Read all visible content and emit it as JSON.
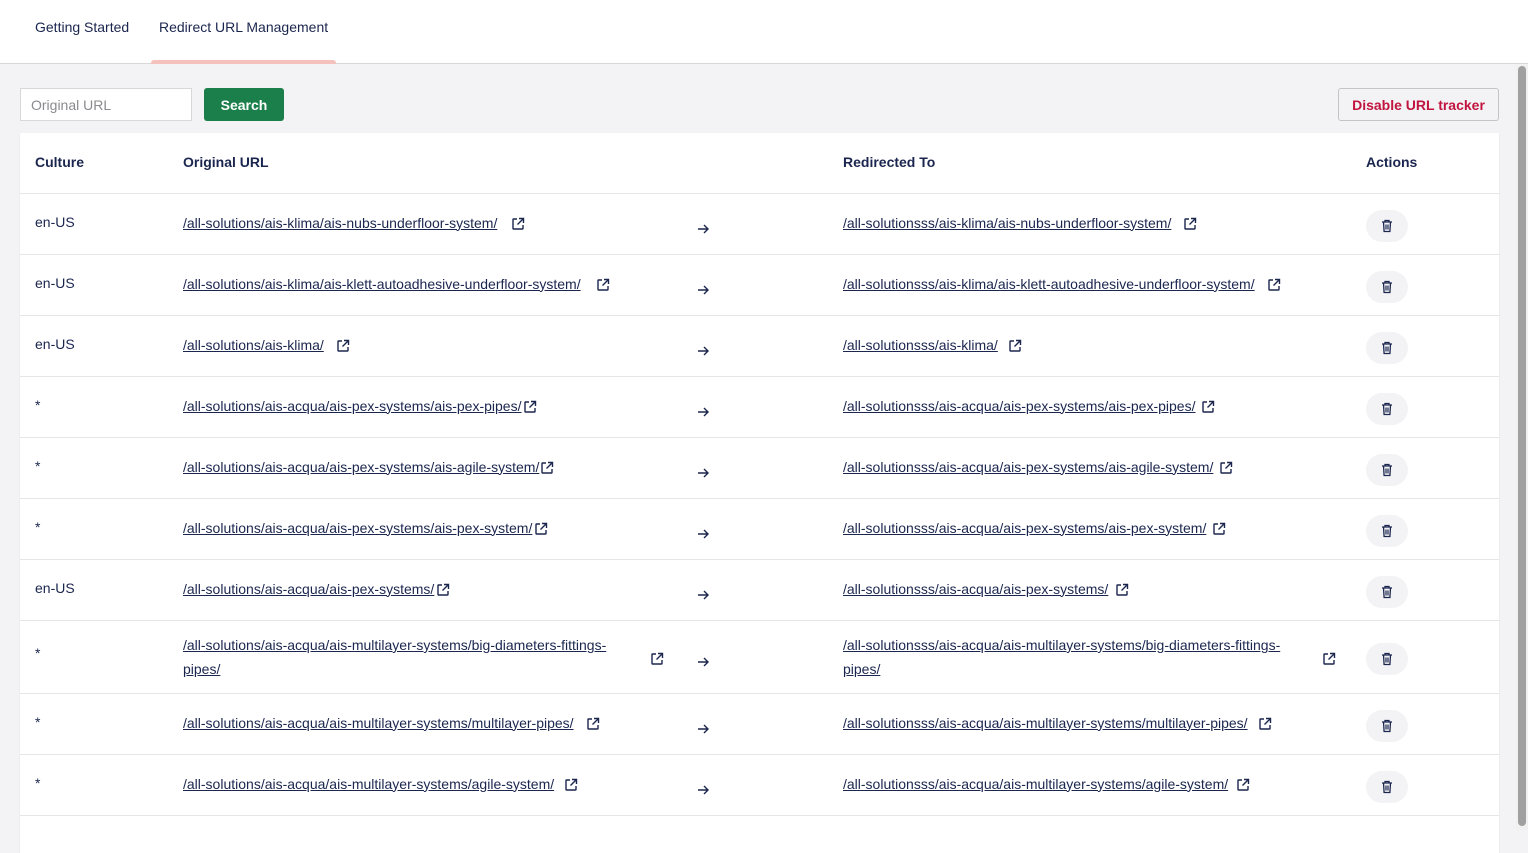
{
  "tabs": [
    {
      "label": "Getting Started"
    },
    {
      "label": "Redirect URL Management"
    }
  ],
  "search": {
    "placeholder": "Original URL",
    "button_label": "Search"
  },
  "disable_button": {
    "label": "Disable URL tracker"
  },
  "table": {
    "headers": {
      "culture": "Culture",
      "original": "Original URL",
      "redirected": "Redirected To",
      "actions": "Actions"
    },
    "rows": [
      {
        "culture": "en-US",
        "original": "/all-solutions/ais-klima/ais-nubs-underfloor-system/",
        "redirected": "/all-solutionsss/ais-klima/ais-nubs-underfloor-system/"
      },
      {
        "culture": "en-US",
        "original": "/all-solutions/ais-klima/ais-klett-autoadhesive-underfloor-system/",
        "redirected": "/all-solutionsss/ais-klima/ais-klett-autoadhesive-underfloor-system/"
      },
      {
        "culture": "en-US",
        "original": "/all-solutions/ais-klima/",
        "redirected": "/all-solutionsss/ais-klima/"
      },
      {
        "culture": "*",
        "original": "/all-solutions/ais-acqua/ais-pex-systems/ais-pex-pipes/",
        "redirected": "/all-solutionsss/ais-acqua/ais-pex-systems/ais-pex-pipes/"
      },
      {
        "culture": "*",
        "original": "/all-solutions/ais-acqua/ais-pex-systems/ais-agile-system/",
        "redirected": "/all-solutionsss/ais-acqua/ais-pex-systems/ais-agile-system/"
      },
      {
        "culture": "*",
        "original": "/all-solutions/ais-acqua/ais-pex-systems/ais-pex-system/",
        "redirected": "/all-solutionsss/ais-acqua/ais-pex-systems/ais-pex-system/"
      },
      {
        "culture": "en-US",
        "original": "/all-solutions/ais-acqua/ais-pex-systems/",
        "redirected": "/all-solutionsss/ais-acqua/ais-pex-systems/"
      },
      {
        "culture": "*",
        "original_line1": "/all-solutions/ais-acqua/ais-multilayer-systems/big-diameters-fittings-",
        "original_line2": "pipes/",
        "redirected_line1": "/all-solutionsss/ais-acqua/ais-multilayer-systems/big-diameters-fittings-",
        "redirected_line2": "pipes/"
      },
      {
        "culture": "*",
        "original": "/all-solutions/ais-acqua/ais-multilayer-systems/multilayer-pipes/",
        "redirected": "/all-solutionsss/ais-acqua/ais-multilayer-systems/multilayer-pipes/"
      },
      {
        "culture": "*",
        "original": "/all-solutions/ais-acqua/ais-multilayer-systems/agile-system/",
        "redirected": "/all-solutionsss/ais-acqua/ais-multilayer-systems/agile-system/"
      }
    ]
  },
  "icons": {
    "external_link": "external-link-icon",
    "arrow": "arrow-right-icon",
    "delete": "trash-icon"
  },
  "colors": {
    "accent_green": "#1b7f4c",
    "danger": "#c1143e",
    "text": "#1b264f",
    "tab_underline": "#f5c1bc"
  }
}
